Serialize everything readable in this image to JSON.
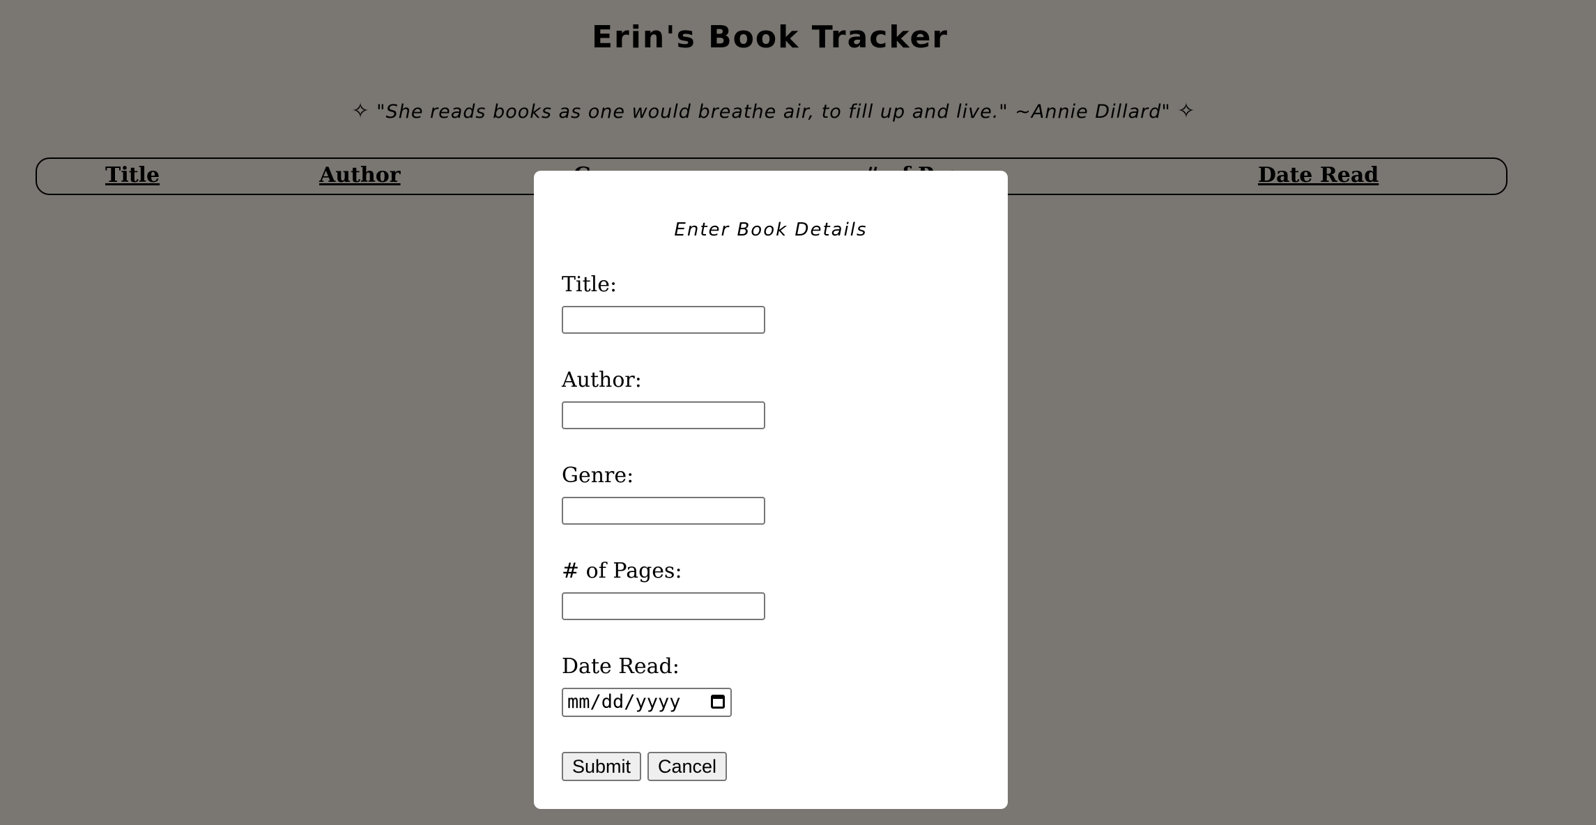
{
  "header": {
    "title": "Erin's Book Tracker",
    "quote": "\"She reads books as one would breathe air, to fill up and live.\" ~Annie Dillard\"",
    "sparkle": "✧"
  },
  "table": {
    "columns": [
      "Title",
      "Author",
      "Genre",
      "# of Pages",
      "Date Read"
    ]
  },
  "modal": {
    "title": "Enter Book Details",
    "fields": [
      {
        "label": "Title:",
        "value": ""
      },
      {
        "label": "Author:",
        "value": ""
      },
      {
        "label": "Genre:",
        "value": ""
      },
      {
        "label": "# of Pages:",
        "value": ""
      },
      {
        "label": "Date Read:",
        "placeholder": "mm/dd/yyyy"
      }
    ],
    "submit_label": "Submit",
    "cancel_label": "Cancel"
  },
  "colors": {
    "overlay_background": "#7a7772",
    "modal_background": "#ffffff"
  }
}
